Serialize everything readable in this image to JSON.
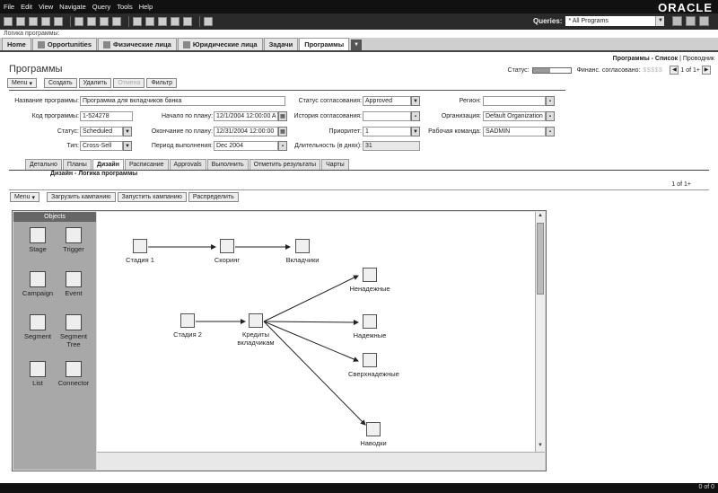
{
  "menubar": [
    "File",
    "Edit",
    "View",
    "Navigate",
    "Query",
    "Tools",
    "Help"
  ],
  "brand": "ORACLE",
  "queries": {
    "label": "Queries:",
    "value": "* All Programs"
  },
  "breadcrumb": "Логика программы:",
  "screen_tabs": [
    "Home",
    "Opportunities",
    "Физические лица",
    "Юридические лица",
    "Задачи",
    "Программы"
  ],
  "right_links": {
    "list": "Программы - Список",
    "explorer": "Проводник"
  },
  "page_title": "Программы",
  "status_area": {
    "status_label": "Статус:",
    "finance_label": "Финанс. согласовано:",
    "dollars": "$$$$$",
    "record_count": "1 of 1+"
  },
  "buttons": {
    "menu": "Menu",
    "create": "Создать",
    "delete": "Удалить",
    "cancel": "Отмена",
    "filter": "Фильтр"
  },
  "form": {
    "name_label": "Название программы:",
    "name_value": "Программа для вкладчиков банка",
    "code_label": "Код программы:",
    "code_value": "1-524278",
    "status_label": "Статус:",
    "status_value": "Scheduled",
    "type_label": "Тип:",
    "type_value": "Cross-Sell",
    "start_label": "Начало по плану:",
    "start_value": "12/1/2004 12:00:00 A",
    "end_label": "Окончание по плану:",
    "end_value": "12/31/2004 12:00:00",
    "period_label": "Период выполнения:",
    "period_value": "Dec 2004",
    "approval_label": "Статус согласования:",
    "approval_value": "Approved",
    "history_label": "История согласования:",
    "history_value": "",
    "priority_label": "Приоритет:",
    "priority_value": "1",
    "duration_label": "Длительность (в днях):",
    "duration_value": "31",
    "region_label": "Регион:",
    "region_value": "",
    "org_label": "Организация:",
    "org_value": "Default Organization",
    "team_label": "Рабочая команда:",
    "team_value": "SADMIN"
  },
  "view_tabs": [
    "Детально",
    "Планы",
    "Дизайн",
    "Расписание",
    "Approvals",
    "Выполнить",
    "Отметить результаты",
    "Чарты"
  ],
  "applet_title": "Дизайн - Логика программы",
  "applet_count": "1 of 1+",
  "applet_buttons": {
    "menu": "Menu",
    "load": "Загрузить кампанию",
    "launch": "Запустить кампанию",
    "distribute": "Распределить"
  },
  "palette": {
    "title": "Objects",
    "items": [
      "Stage",
      "Trigger",
      "Campaign",
      "Event",
      "Segment",
      "Segment Tree",
      "List",
      "Connector"
    ]
  },
  "nodes": {
    "stage1": "Стадия 1",
    "scoring": "Скоринг",
    "depositors": "Вкладчики",
    "stage2": "Стадия 2",
    "credits": "Кредиты вкладчикам",
    "unreliable": "Ненадежные",
    "reliable": "Надежные",
    "super_reliable": "Сверхнадежные",
    "leads": "Наводки"
  },
  "status_bar_right": "0 of 0"
}
